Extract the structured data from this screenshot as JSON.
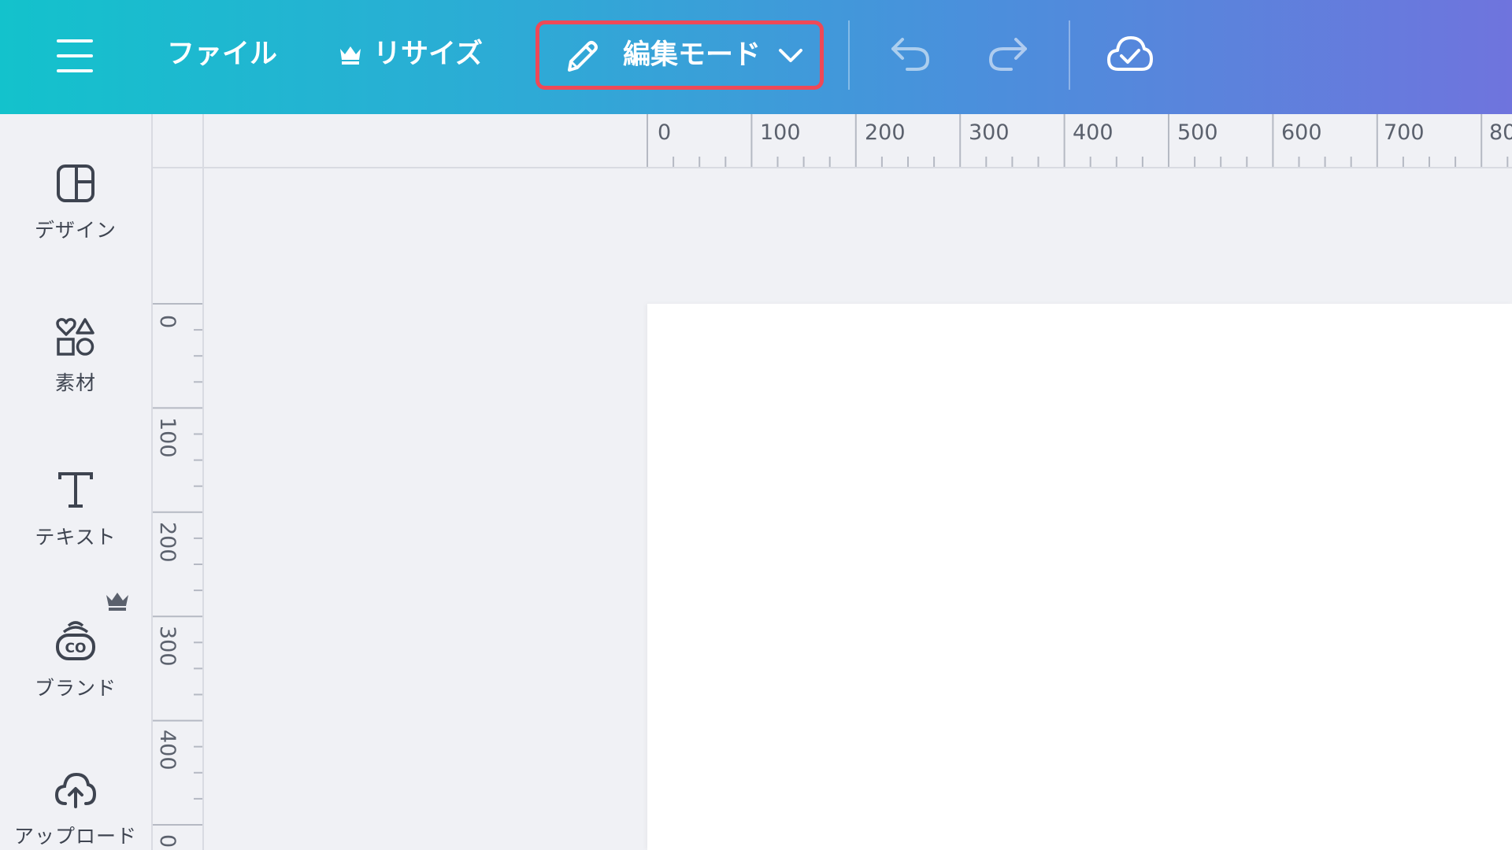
{
  "toolbar": {
    "file_label": "ファイル",
    "resize_label": "リサイズ",
    "edit_mode_label": "編集モード",
    "icons": {
      "menu": "hamburger-icon",
      "resize": "crown-icon",
      "edit_mode": "pencil-icon",
      "dropdown": "chevron-down-icon",
      "undo": "undo-icon",
      "redo": "redo-icon",
      "save": "cloud-check-icon"
    },
    "highlight_color": "#ee4957"
  },
  "sidebar": {
    "items": [
      {
        "label": "デザイン",
        "icon": "layout-icon"
      },
      {
        "label": "素材",
        "icon": "shapes-icon"
      },
      {
        "label": "テキスト",
        "icon": "text-icon"
      },
      {
        "label": "ブランド",
        "icon": "brand-icon",
        "premium_icon": "crown-icon"
      },
      {
        "label": "アップロード",
        "icon": "upload-cloud-icon"
      }
    ]
  },
  "rulers": {
    "horizontal_labels": [
      "0",
      "100",
      "200",
      "300",
      "400",
      "500",
      "600",
      "700",
      "80"
    ],
    "vertical_labels": [
      "0",
      "100",
      "200",
      "300",
      "400",
      "0"
    ]
  },
  "colors": {
    "gradient_start": "#13c2cc",
    "gradient_end": "#6f74dd",
    "workspace": "#f0f1f5",
    "page": "#ffffff"
  }
}
